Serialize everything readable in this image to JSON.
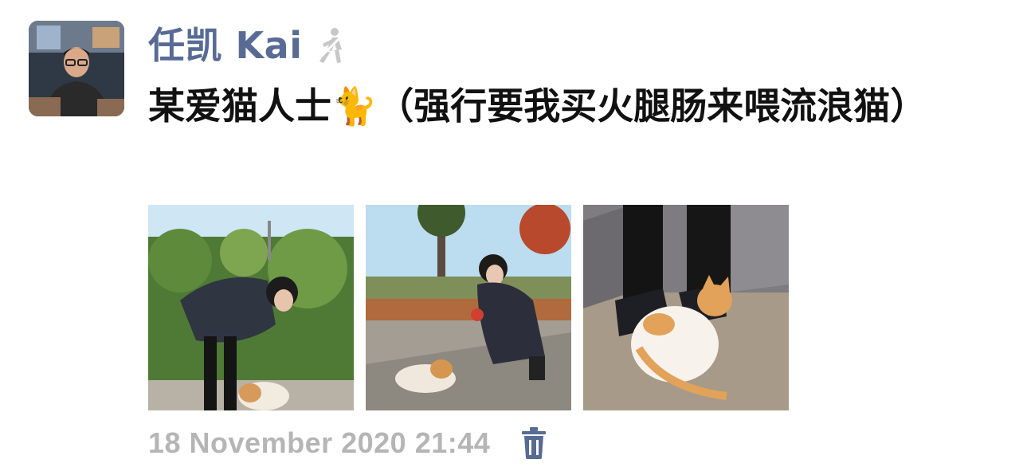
{
  "post": {
    "author": "任凯 Kai",
    "text": "某爱猫人士🐈（强行要我买火腿肠来喂流浪猫）",
    "timestamp": "18 November 2020 21:44",
    "photos": [
      {
        "icon": "photo-woman-petting-cat-bushes"
      },
      {
        "icon": "photo-woman-feeding-cat-path"
      },
      {
        "icon": "photo-cat-at-feet"
      }
    ]
  },
  "icons": {
    "visibility": "walking-person-icon",
    "delete": "trash-icon"
  },
  "colors": {
    "author": "#576b95",
    "timestamp": "#b5b5b5",
    "text": "#111111"
  }
}
